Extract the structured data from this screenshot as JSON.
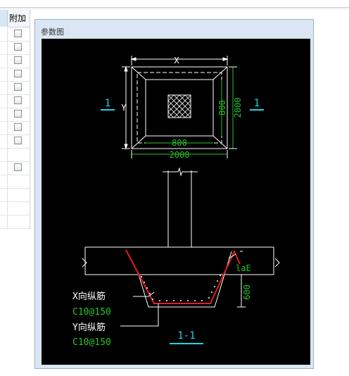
{
  "grid": {
    "header": "附加",
    "rows": [
      {
        "checkbox": true
      },
      {
        "checkbox": true
      },
      {
        "checkbox": true
      },
      {
        "checkbox": true
      },
      {
        "checkbox": true
      },
      {
        "checkbox": true
      },
      {
        "checkbox": true
      },
      {
        "checkbox": true
      },
      {
        "checkbox": true
      },
      {
        "checkbox": false
      },
      {
        "checkbox": true
      },
      {
        "checkbox": false
      },
      {
        "checkbox": false
      },
      {
        "checkbox": false
      },
      {
        "checkbox": false
      }
    ]
  },
  "panel": {
    "title": "参数图"
  },
  "drawing": {
    "plan": {
      "dim_x": "X",
      "dim_y": "Y",
      "inner_width": "800",
      "inner_height": "800",
      "outer_width": "2000",
      "outer_height": "2000",
      "section_mark_left": "1",
      "section_mark_right": "1"
    },
    "section": {
      "anchorage_label": "laE",
      "depth_label": "600",
      "x_bar_label": "X向纵筋",
      "x_bar_spec": "C10@150",
      "y_bar_label": "Y向纵筋",
      "y_bar_spec": "C10@150",
      "section_title": "1-1"
    },
    "colors": {
      "background": "#000000",
      "outline": "#ffffff",
      "dimension_green": "#27c427",
      "section_cyan": "#1fd3e6",
      "rebar_red": "#e01e1e"
    }
  }
}
